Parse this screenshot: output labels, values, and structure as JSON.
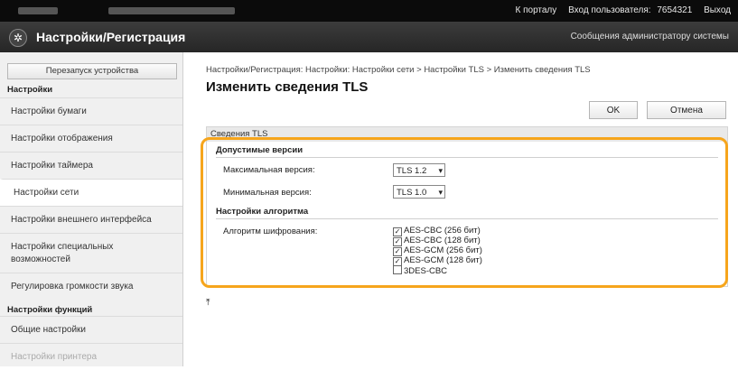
{
  "topbar": {
    "portal_link": "К порталу",
    "login_label": "Вход пользователя:",
    "user_id": "7654321",
    "logout_link": "Выход"
  },
  "appbar": {
    "title": "Настройки/Регистрация",
    "admin_message": "Сообщения администратору системы"
  },
  "sidebar": {
    "restart_button": "Перезапуск устройства",
    "settings_header": "Настройки",
    "items": [
      {
        "label": "Настройки бумаги"
      },
      {
        "label": "Настройки отображения"
      },
      {
        "label": "Настройки таймера"
      },
      {
        "label": "Настройки сети"
      },
      {
        "label": "Настройки внешнего интерфейса"
      },
      {
        "label": "Настройки специальных возможностей"
      },
      {
        "label": "Регулировка громкости звука"
      }
    ],
    "functions_header": "Настройки функций",
    "function_items": [
      {
        "label": "Общие настройки"
      },
      {
        "label": "Настройки принтера"
      }
    ]
  },
  "main": {
    "breadcrumb": "Настройки/Регистрация: Настройки: Настройки сети > Настройки TLS > Изменить сведения TLS",
    "title": "Изменить сведения TLS",
    "ok_button": "OK",
    "cancel_button": "Отмена",
    "section_title": "Сведения TLS",
    "versions_header": "Допустимые версии",
    "max_version_label": "Максимальная версия:",
    "max_version_value": "TLS 1.2",
    "min_version_label": "Минимальная версия:",
    "min_version_value": "TLS 1.0",
    "algorithm_header": "Настройки алгоритма",
    "cipher_label": "Алгоритм шифрования:",
    "ciphers": [
      {
        "label": "AES-CBC (256 бит)",
        "checked": true
      },
      {
        "label": "AES-CBC (128 бит)",
        "checked": true
      },
      {
        "label": "AES-GCM (256 бит)",
        "checked": true
      },
      {
        "label": "AES-GCM (128 бит)",
        "checked": true
      },
      {
        "label": "3DES-CBC",
        "checked": false
      }
    ],
    "to_top_icon": "to-top-icon"
  },
  "colors": {
    "highlight": "#f6a51c",
    "topbar": "#0b0b0b",
    "appbar": "#2f2f2f"
  }
}
